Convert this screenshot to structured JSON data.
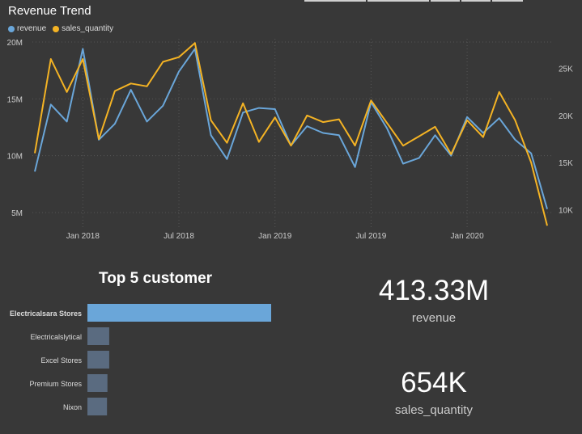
{
  "report": {
    "tabs_count": 5
  },
  "trend": {
    "title": "Revenue Trend",
    "legend": [
      {
        "label": "revenue",
        "color": "#6aa6d9"
      },
      {
        "label": "sales_quantity",
        "color": "#f4b324"
      }
    ]
  },
  "chart_data": [
    {
      "type": "line",
      "title": "Revenue Trend",
      "x": [
        "2017-10",
        "2017-11",
        "2017-12",
        "2018-01",
        "2018-02",
        "2018-03",
        "2018-04",
        "2018-05",
        "2018-06",
        "2018-07",
        "2018-08",
        "2018-09",
        "2018-10",
        "2018-11",
        "2018-12",
        "2019-01",
        "2019-02",
        "2019-03",
        "2019-04",
        "2019-05",
        "2019-06",
        "2019-07",
        "2019-08",
        "2019-09",
        "2019-10",
        "2019-11",
        "2019-12",
        "2020-01",
        "2020-02",
        "2020-03",
        "2020-04",
        "2020-05",
        "2020-06"
      ],
      "x_tick_labels": [
        "Jan 2018",
        "Jul 2018",
        "Jan 2019",
        "Jul 2019",
        "Jan 2020"
      ],
      "y_left_ticks": [
        "5M",
        "10M",
        "15M",
        "20M"
      ],
      "y_right_ticks": [
        "10K",
        "15K",
        "20K",
        "25K"
      ],
      "y_left_range": [
        4000000,
        20000000
      ],
      "y_right_range": [
        8500,
        27800
      ],
      "series": [
        {
          "name": "revenue",
          "axis": "left",
          "color": "#6aa6d9",
          "values": [
            8600000,
            14500000,
            13000000,
            19400000,
            11400000,
            12800000,
            15800000,
            13000000,
            14400000,
            17400000,
            19400000,
            11800000,
            9700000,
            13800000,
            14200000,
            14100000,
            10900000,
            12600000,
            12000000,
            11800000,
            9000000,
            14700000,
            12400000,
            9300000,
            9800000,
            11800000,
            10000000,
            13400000,
            12000000,
            13300000,
            11400000,
            10200000,
            5300000
          ]
        },
        {
          "name": "sales_quantity",
          "axis": "right",
          "color": "#f4b324",
          "values": [
            16000,
            26000,
            22500,
            26000,
            17500,
            22600,
            23400,
            23100,
            25700,
            26200,
            27700,
            19500,
            17100,
            21300,
            17200,
            19800,
            16800,
            20000,
            19300,
            19600,
            16800,
            21600,
            19200,
            16800,
            17800,
            18800,
            15900,
            19500,
            17700,
            22500,
            19500,
            15000,
            8300
          ]
        }
      ]
    },
    {
      "type": "bar",
      "title": "Top 5 customer",
      "orientation": "horizontal",
      "categories": [
        "Electricalsara Stores",
        "Electricalslytical",
        "Excel Stores",
        "Premium Stores",
        "Nixon"
      ],
      "values": [
        413,
        49,
        49,
        45,
        44
      ],
      "highlight_color": "#6aa6d9",
      "bar_color": "#5a6b80"
    }
  ],
  "customers": {
    "title": "Top 5 customer"
  },
  "kpis": {
    "revenue_value": "413.33M",
    "revenue_label": "revenue",
    "quantity_value": "654K",
    "quantity_label": "sales_quantity"
  }
}
